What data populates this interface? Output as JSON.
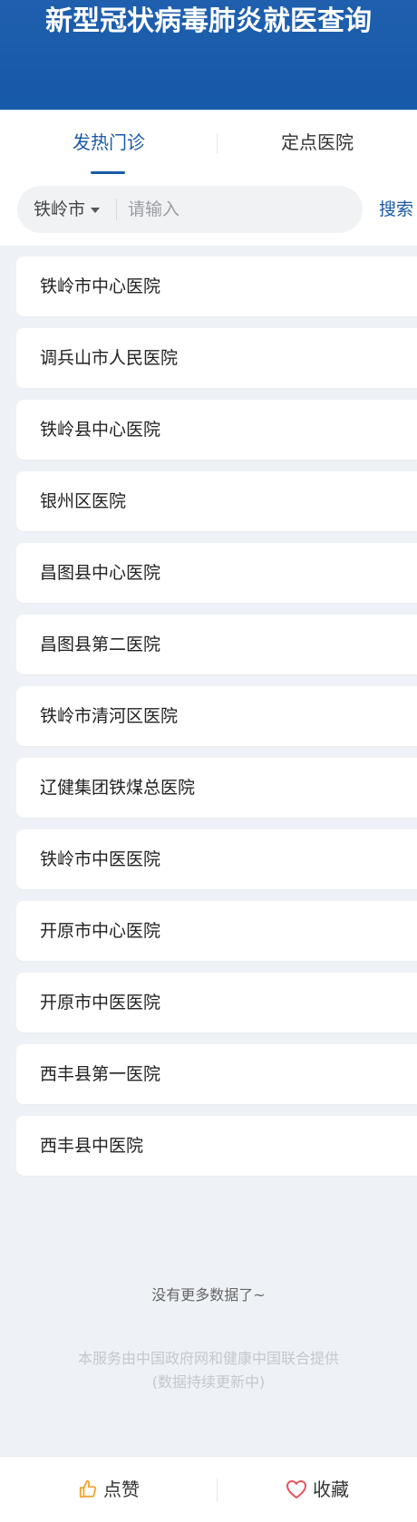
{
  "header": {
    "title": "新型冠状病毒肺炎就医查询"
  },
  "tabs": [
    {
      "label": "发热门诊",
      "active": true
    },
    {
      "label": "定点医院",
      "active": false
    }
  ],
  "search": {
    "city": "铁岭市",
    "placeholder": "请输入",
    "value": "",
    "button_label": "搜索"
  },
  "hospitals": [
    "铁岭市中心医院",
    "调兵山市人民医院",
    "铁岭县中心医院",
    "银州区医院",
    "昌图县中心医院",
    "昌图县第二医院",
    "铁岭市清河区医院",
    "辽健集团铁煤总医院",
    "铁岭市中医医院",
    "开原市中心医院",
    "开原市中医医院",
    "西丰县第一医院",
    "西丰县中医院"
  ],
  "list_end_text": "没有更多数据了~",
  "footer_note": {
    "line1": "本服务由中国政府网和健康中国联合提供",
    "line2": "(数据持续更新中)"
  },
  "bottom_bar": {
    "like_label": "点赞",
    "like_icon": "thumbs-up-icon",
    "favorite_label": "收藏",
    "favorite_icon": "heart-icon"
  },
  "colors": {
    "brand_blue": "#1a5ba7",
    "header_bg": "#1659a8",
    "page_bg": "#eef2f6",
    "like_icon_color": "#f0a630",
    "favorite_icon_color": "#e8535d"
  }
}
